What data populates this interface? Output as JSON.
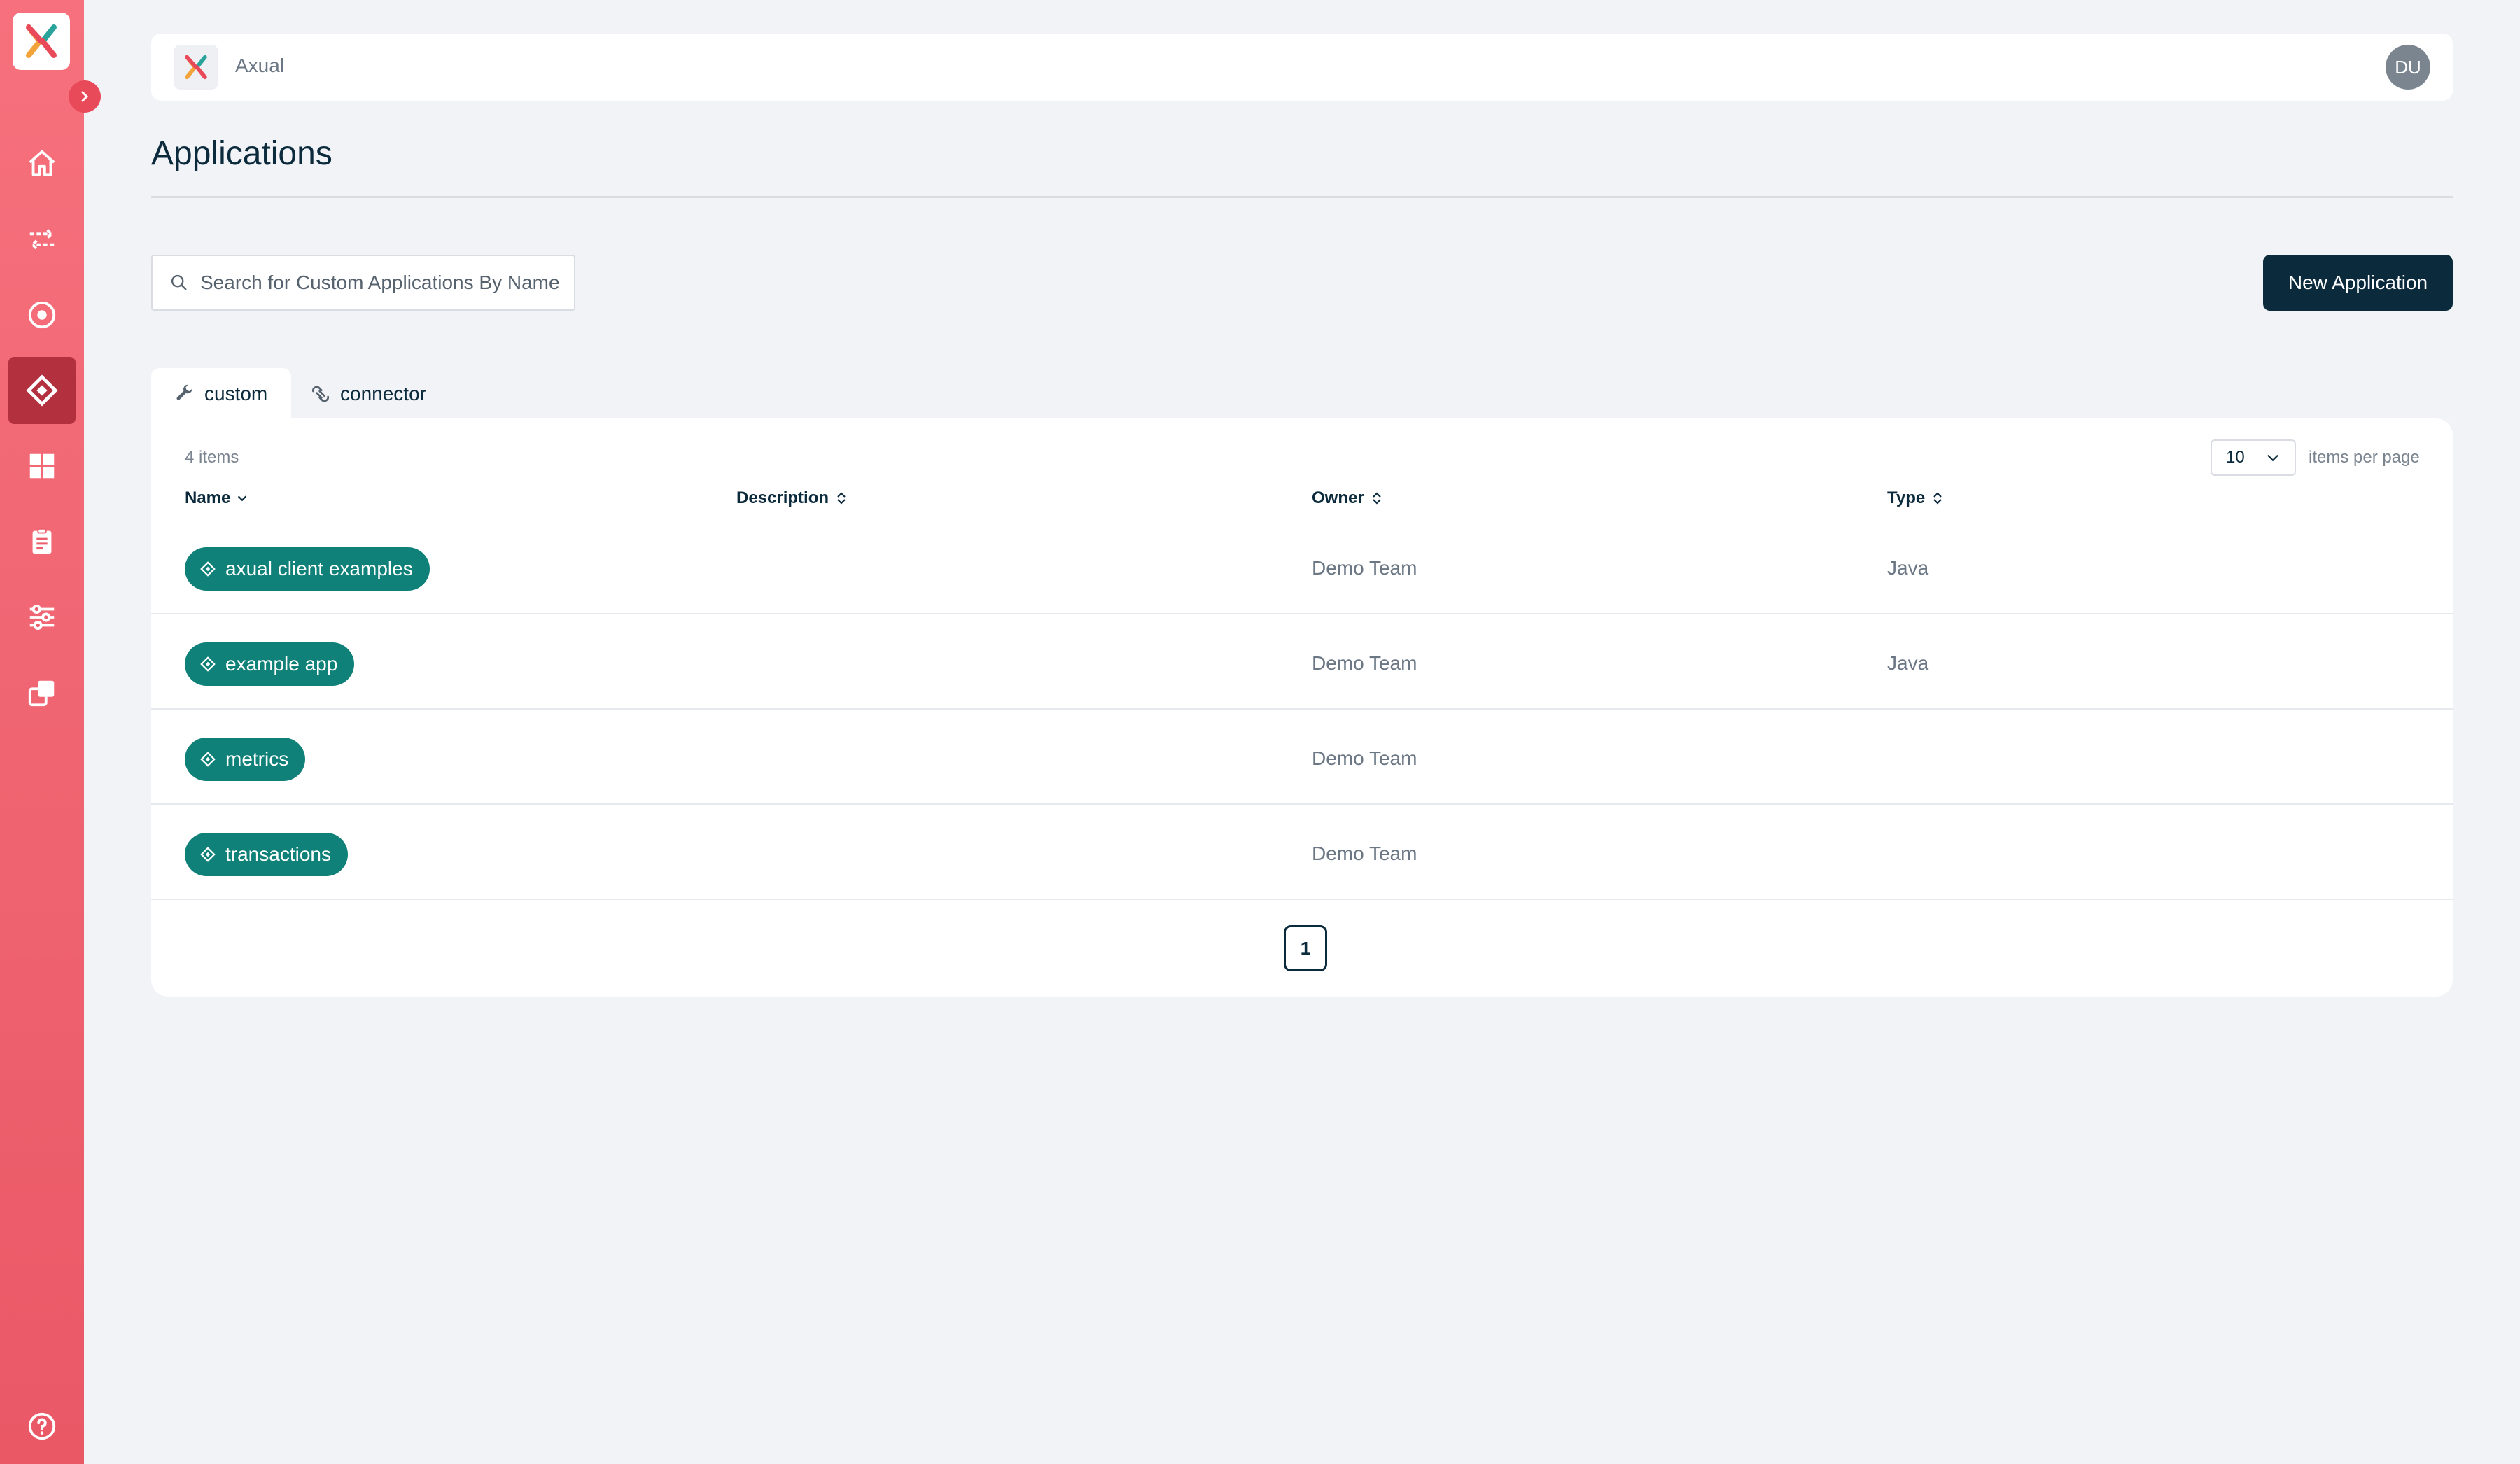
{
  "app": {
    "name": "Axual",
    "user_initials": "DU"
  },
  "page": {
    "title": "Applications"
  },
  "search": {
    "placeholder": "Search for Custom Applications By Name",
    "value": ""
  },
  "actions": {
    "new_application": "New Application"
  },
  "tabs": [
    {
      "label": "custom",
      "icon": "wrench-icon",
      "active": true
    },
    {
      "label": "connector",
      "icon": "connector-icon",
      "active": false
    }
  ],
  "table": {
    "item_count": "4 items",
    "per_page": "10",
    "per_page_label": "items per page",
    "columns": [
      "Name",
      "Description",
      "Owner",
      "Type"
    ],
    "rows": [
      {
        "name": "axual client examples",
        "description": "",
        "owner": "Demo Team",
        "type": "Java"
      },
      {
        "name": "example app",
        "description": "",
        "owner": "Demo Team",
        "type": "Java"
      },
      {
        "name": "metrics",
        "description": "",
        "owner": "Demo Team",
        "type": ""
      },
      {
        "name": "transactions",
        "description": "",
        "owner": "Demo Team",
        "type": ""
      }
    ],
    "current_page": "1"
  },
  "sidebar": {
    "items": [
      {
        "icon": "home-icon",
        "active": false
      },
      {
        "icon": "streams-icon",
        "active": false
      },
      {
        "icon": "environments-icon",
        "active": false
      },
      {
        "icon": "applications-icon",
        "active": true
      },
      {
        "icon": "dashboard-icon",
        "active": false
      },
      {
        "icon": "clipboard-icon",
        "active": false
      },
      {
        "icon": "settings-sliders-icon",
        "active": false
      },
      {
        "icon": "copy-icon",
        "active": false
      }
    ],
    "help_icon": "help-icon"
  },
  "colors": {
    "sidebar_top": "#f6717d",
    "sidebar_bottom": "#ea5866",
    "primary_dark": "#0b2a3c",
    "pill_teal": "#0f8178"
  }
}
